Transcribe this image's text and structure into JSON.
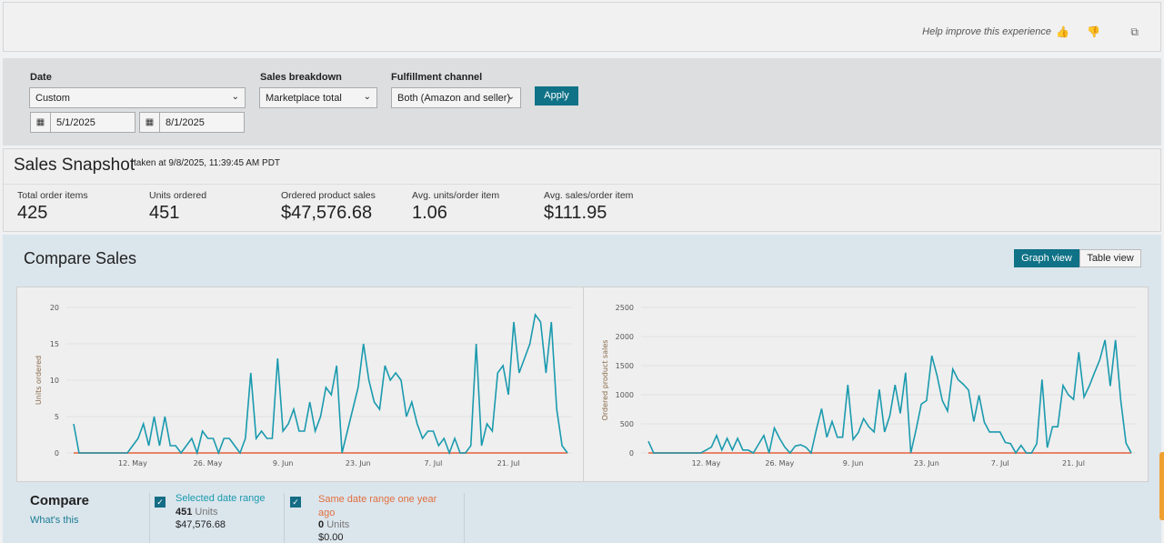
{
  "header": {
    "help_text": "Help improve this experience",
    "icons": [
      "thumbs-up-icon",
      "thumbs-down-icon",
      "copy-icon"
    ]
  },
  "filters": {
    "date_label": "Date",
    "date_value": "Custom",
    "start_date": "5/1/2025",
    "end_date": "8/1/2025",
    "breakdown_label": "Sales breakdown",
    "breakdown_value": "Marketplace total",
    "channel_label": "Fulfillment channel",
    "channel_value": "Both (Amazon and seller)",
    "apply": "Apply"
  },
  "snapshot": {
    "title": "Sales Snapshot",
    "taken": "taken at 9/8/2025, 11:39:45 AM PDT",
    "metrics": [
      {
        "label": "Total order items",
        "value": "425"
      },
      {
        "label": "Units ordered",
        "value": "451"
      },
      {
        "label": "Ordered product sales",
        "value": "$47,576.68"
      },
      {
        "label": "Avg. units/order item",
        "value": "1.06"
      },
      {
        "label": "Avg. sales/order item",
        "value": "$111.95"
      }
    ]
  },
  "compare": {
    "title": "Compare Sales",
    "graph_view": "Graph view",
    "table_view": "Table view",
    "footer": {
      "title": "Compare",
      "whats_this": "What's this",
      "selected": {
        "label": "Selected date range",
        "units": "451",
        "units_word": "Units",
        "sales": "$47,576.68"
      },
      "last_year": {
        "label": "Same date range one year ago",
        "units": "0",
        "units_word": "Units",
        "sales": "$0.00"
      }
    }
  },
  "colors": {
    "current": "#1a9aae",
    "last_year": "#e8846a",
    "accent": "#0f7287"
  },
  "chart_data": [
    {
      "type": "line",
      "ylabel": "Units ordered",
      "ylim": [
        0,
        20
      ],
      "yticks": [
        "0",
        "5",
        "10",
        "15",
        "20"
      ],
      "xticks": [
        {
          "index": 11,
          "label": "12. May"
        },
        {
          "index": 25,
          "label": "26. May"
        },
        {
          "index": 39,
          "label": "9. Jun"
        },
        {
          "index": 53,
          "label": "23. Jun"
        },
        {
          "index": 67,
          "label": "7. Jul"
        },
        {
          "index": 81,
          "label": "21. Jul"
        }
      ],
      "x_start": "2025-05-01",
      "x_end": "2025-08-01",
      "series": [
        {
          "name": "Selected date range",
          "values": [
            4,
            0,
            0,
            0,
            0,
            0,
            0,
            0,
            0,
            0,
            0,
            1,
            2,
            4,
            1,
            5,
            1,
            5,
            1,
            1,
            0,
            1,
            2,
            0,
            3,
            2,
            2,
            0,
            2,
            2,
            1,
            0,
            2,
            11,
            2,
            3,
            2,
            2,
            13,
            3,
            4,
            6,
            3,
            3,
            7,
            3,
            5,
            9,
            8,
            12,
            0,
            3,
            6,
            9,
            15,
            10,
            7,
            6,
            12,
            10,
            11,
            10,
            5,
            7,
            4,
            2,
            3,
            3,
            1,
            2,
            0,
            2,
            0,
            0,
            1,
            15,
            1,
            4,
            3,
            11,
            12,
            8,
            18,
            11,
            13,
            15,
            19,
            18,
            11,
            18,
            6,
            1,
            0
          ]
        },
        {
          "name": "Same date range one year ago",
          "values": "all 0"
        }
      ]
    },
    {
      "type": "line",
      "ylabel": "Ordered product sales",
      "ylim": [
        0,
        2500
      ],
      "yticks": [
        "0",
        "500",
        "1000",
        "1500",
        "2000",
        "2500"
      ],
      "xticks": [
        {
          "index": 11,
          "label": "12. May"
        },
        {
          "index": 25,
          "label": "26. May"
        },
        {
          "index": 39,
          "label": "9. Jun"
        },
        {
          "index": 53,
          "label": "23. Jun"
        },
        {
          "index": 67,
          "label": "7. Jul"
        },
        {
          "index": 81,
          "label": "21. Jul"
        }
      ],
      "x_start": "2025-05-01",
      "x_end": "2025-08-01",
      "series": [
        {
          "name": "Selected date range",
          "values": [
            200,
            0,
            0,
            0,
            0,
            0,
            0,
            0,
            0,
            0,
            0,
            50,
            100,
            300,
            50,
            250,
            50,
            250,
            50,
            50,
            0,
            150,
            300,
            0,
            430,
            250,
            100,
            0,
            120,
            140,
            100,
            0,
            400,
            760,
            270,
            540,
            270,
            270,
            1170,
            230,
            350,
            590,
            450,
            360,
            1090,
            360,
            640,
            1170,
            680,
            1380,
            0,
            400,
            840,
            900,
            1670,
            1330,
            900,
            720,
            1440,
            1260,
            1180,
            1080,
            540,
            990,
            530,
            360,
            360,
            360,
            180,
            160,
            0,
            130,
            0,
            0,
            160,
            1260,
            90,
            450,
            450,
            1160,
            1000,
            920,
            1730,
            960,
            1150,
            1380,
            1600,
            1940,
            1150,
            1940,
            900,
            170,
            0
          ]
        },
        {
          "name": "Same date range one year ago",
          "values": "all 0"
        }
      ]
    }
  ]
}
